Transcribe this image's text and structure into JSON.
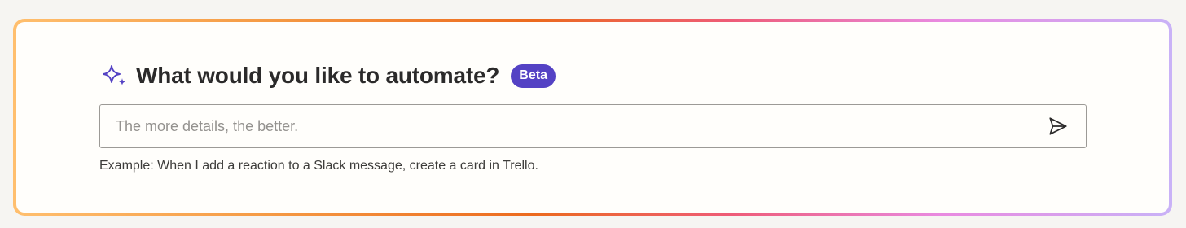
{
  "prompt_card": {
    "title": "What would you like to automate?",
    "badge": "Beta",
    "input_value": "",
    "input_placeholder": "The more details, the better.",
    "example_text": "Example: When I add a reaction to a Slack message, create a card in Trello.",
    "icons": {
      "title_icon": "sparkle-icon",
      "submit_icon": "send-icon"
    }
  },
  "colors": {
    "page_background": "#f6f5f2",
    "card_background": "#fffefb",
    "badge_background": "#5442c4",
    "sparkle_icon": "#5442c4",
    "border_gradient": [
      "#ffbf6e",
      "#f59a44",
      "#ec6a1e",
      "#ee5c78",
      "#e98ae0",
      "#c9b2f7"
    ]
  }
}
